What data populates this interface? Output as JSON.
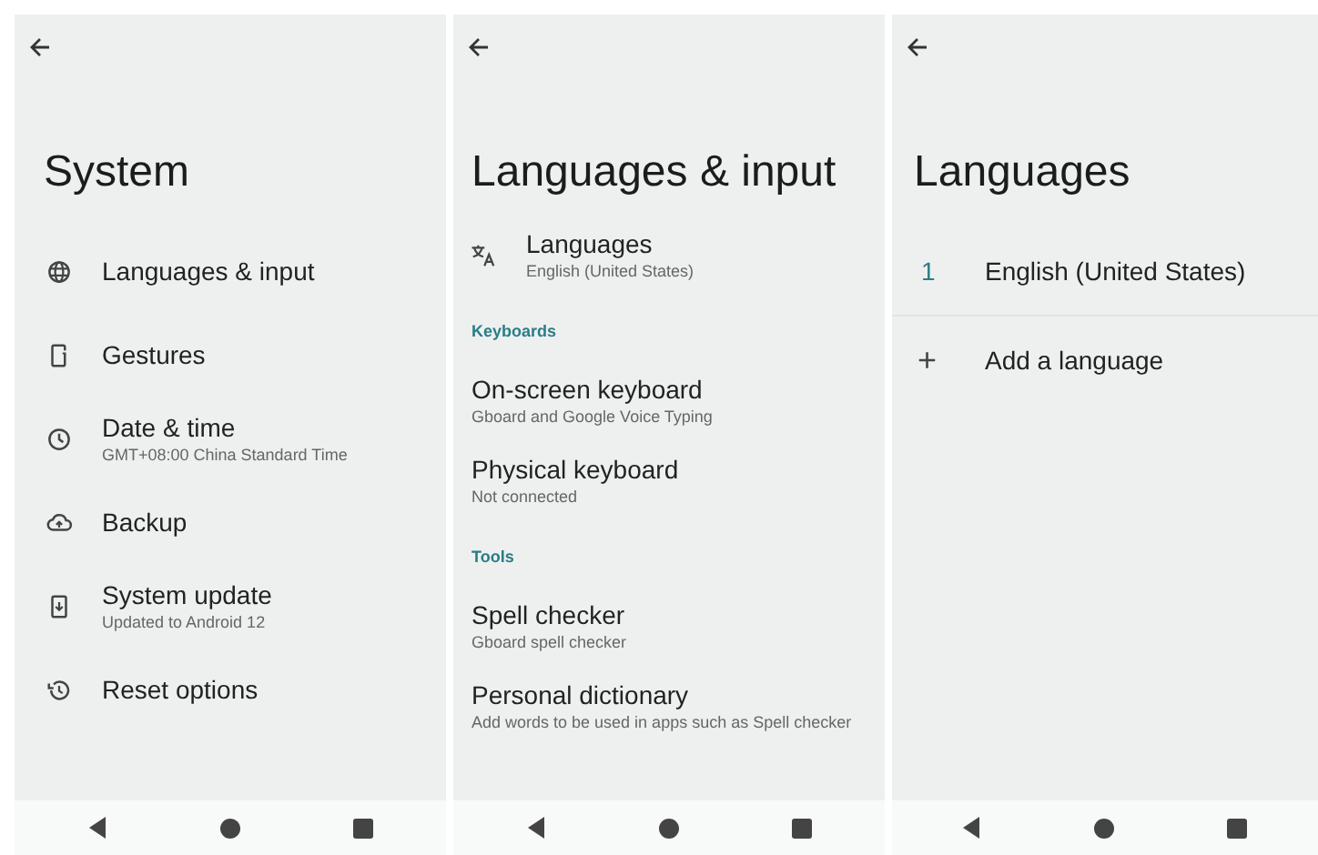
{
  "panels": [
    {
      "kind": "system",
      "title": "System",
      "items": [
        {
          "title": "Languages & input"
        },
        {
          "title": "Gestures"
        },
        {
          "title": "Date & time",
          "subtitle": "GMT+08:00 China Standard Time"
        },
        {
          "title": "Backup"
        },
        {
          "title": "System update",
          "subtitle": "Updated to Android 12"
        },
        {
          "title": "Reset options"
        }
      ]
    },
    {
      "kind": "languages_input",
      "title": "Languages & input",
      "items": [
        {
          "kind": "item",
          "title": "Languages",
          "subtitle": "English (United States)"
        },
        {
          "kind": "header",
          "title": "Keyboards"
        },
        {
          "kind": "item",
          "title": "On-screen keyboard",
          "subtitle": "Gboard and Google Voice Typing"
        },
        {
          "kind": "item",
          "title": "Physical keyboard",
          "subtitle": "Not connected"
        },
        {
          "kind": "header",
          "title": "Tools"
        },
        {
          "kind": "item",
          "title": "Spell checker",
          "subtitle": "Gboard spell checker"
        },
        {
          "kind": "item",
          "title": "Personal dictionary",
          "subtitle": "Add words to be used in apps such as Spell checker"
        }
      ]
    },
    {
      "kind": "languages",
      "title": "Languages",
      "items": [
        {
          "kind": "language",
          "number": "1",
          "title": "English (United States)"
        },
        {
          "kind": "add",
          "symbol": "+",
          "title": "Add a language"
        }
      ]
    }
  ]
}
